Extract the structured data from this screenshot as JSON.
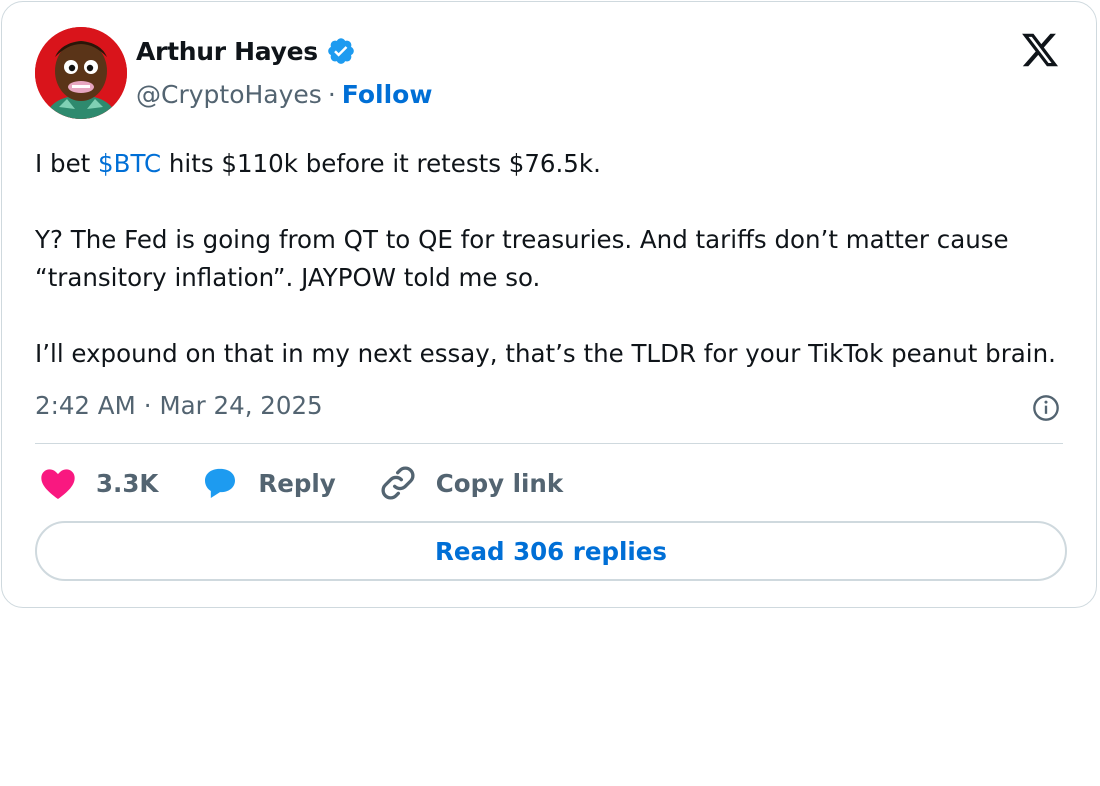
{
  "tweet": {
    "author": {
      "name": "Arthur Hayes",
      "handle": "@CryptoHayes",
      "separator": "·",
      "follow_label": "Follow",
      "verified": true,
      "avatar_icon": "cartoon-avatar-icon"
    },
    "platform_icon": "x-logo-icon",
    "text": {
      "line1_prefix": "I bet ",
      "line1_cashtag": "$BTC",
      "line1_suffix": " hits $110k before it retests $76.5k.",
      "paragraph2": "Y? The Fed is going from QT to QE for treasuries. And tariffs don’t matter cause “transitory inflation”. JAYPOW told me so.",
      "paragraph3": "I’ll expound on that in my next essay, that’s the TLDR for your TikTok peanut brain."
    },
    "time": "2:42 AM",
    "date_separator": "·",
    "date": "Mar 24, 2025",
    "actions": {
      "like_count": "3.3K",
      "reply_label": "Reply",
      "copy_label": "Copy link"
    },
    "read_replies_label": "Read 306 replies",
    "colors": {
      "link": "#006fd6",
      "heart": "#f91880",
      "reply_bubble": "#1d9bf0",
      "muted": "#536471",
      "border": "#cfd9de"
    }
  }
}
